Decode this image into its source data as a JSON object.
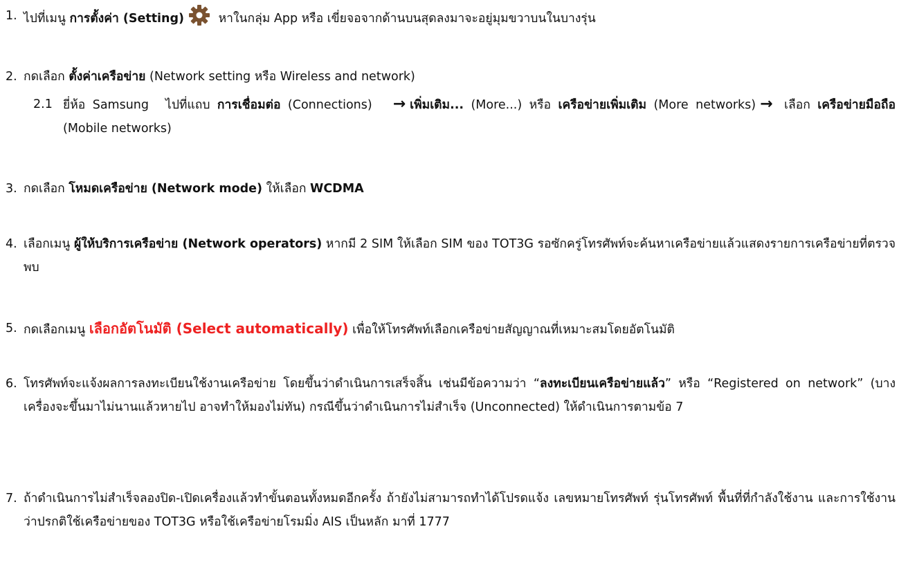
{
  "steps": [
    {
      "num": "1.",
      "p1": "ไปที่เมนู ",
      "b1": "การตั้งค่า (Setting)",
      "p2": " หาในกลุ่ม App หรือ เขี่ยจอจากด้านบนสุดลงมาจะอยู่มุมขวาบนในบางรุ่น",
      "icon": "gear-icon"
    },
    {
      "num": "2.",
      "p1": "กดเลือก ",
      "b1": "ตั้งค่าเครือข่าย",
      "p2": " (Network setting หรือ Wireless and network)"
    },
    {
      "num": "3.",
      "p1": "กดเลือก ",
      "b1": "โหมดเครือข่าย (Network mode)",
      "p2": " ให้เลือก ",
      "b2": "WCDMA"
    },
    {
      "num": "4.",
      "p1": "เลือกเมนู ",
      "b1": "ผู้ให้บริการเครือข่าย (Network operators)",
      "p2": " หากมี 2 SIM ให้เลือก SIM ของ TOT3G รอซักครู่โทรศัพท์จะค้นหาเครือข่ายแล้วแสดงรายการเครือข่ายที่ตรวจพบ"
    },
    {
      "num": "5.",
      "p1": "กดเลือกเมนู ",
      "r1": "เลือกอัตโนมัติ (Select automatically)",
      "p2": " เพื่อให้โทรศัพท์เลือกเครือข่ายสัญญาณที่เหมาะสมโดยอัตโนมัติ"
    },
    {
      "num": "6.",
      "p1": "โทรศัพท์จะแจ้งผลการลงทะเบียนใช้งานเครือข่าย โดยขึ้นว่าดำเนินการเสร็จสิ้น เช่นมีข้อความว่า “",
      "b1": "ลงทะเบียนเครือข่ายแล้ว",
      "p2": "” หรือ “Registered on network” (บางเครื่องจะขึ้นมาไม่นานแล้วหายไป อาจทำให้มองไม่ทัน) กรณีขึ้นว่าดำเนินการไม่สำเร็จ (Unconnected) ให้ดำเนินการตามข้อ 7"
    },
    {
      "num": "7.",
      "p1": "ถ้าดำเนินการไม่สำเร็จลองปิด-เปิดเครื่องแล้วทำขั้นตอนทั้งหมดอีกครั้ง ถ้ายังไม่สามารถทำได้โปรดแจ้ง เลขหมายโทรศัพท์ รุ่นโทรศัพท์ พื้นที่ที่กำลังใช้งาน และการใช้งานว่าปรกติใช้เครือข่ายของ TOT3G หรือใช้เครือข่ายโรมมิ่ง AIS เป็นหลัก มาที่ 1777"
    }
  ],
  "substep": {
    "num": "2.1",
    "p1": "ยี่ห้อ Samsung",
    "p2": "ไปที่แถบ ",
    "b1": "การเชื่อมต่อ",
    "p3": " (Connections)",
    "b2": "เพิ่มเติม...",
    "p4": " (More...) หรือ ",
    "b3": "เครือข่ายเพิ่มเติม",
    "p5": " (More networks)",
    "p6": " เลือก ",
    "b4": "เครือข่ายมือถือ",
    "p7": " (Mobile networks)",
    "arrow": "→"
  },
  "colors": {
    "text": "#111111",
    "highlight": "#ee2222",
    "gear": "#7a5230"
  }
}
